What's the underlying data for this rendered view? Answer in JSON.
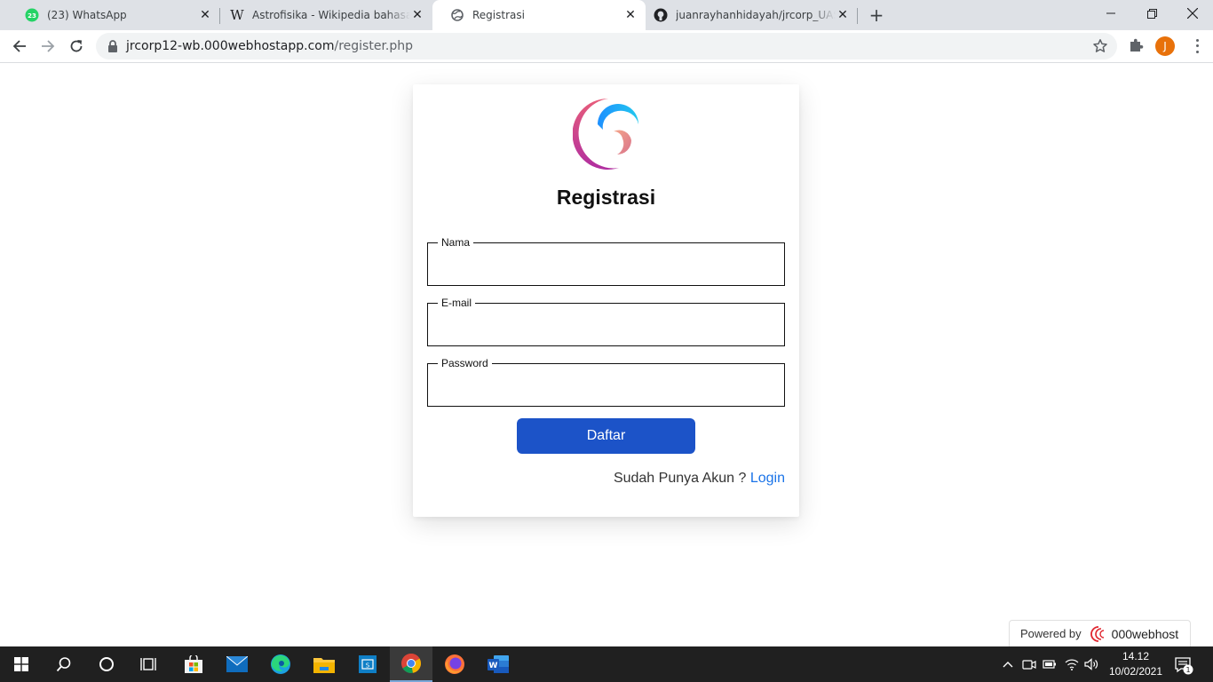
{
  "browser": {
    "tabs": [
      {
        "title": "(23) WhatsApp",
        "badge": "23",
        "icon": "whatsapp-icon",
        "active": false
      },
      {
        "title": "Astrofisika - Wikipedia bahasa Indonesia",
        "icon": "wikipedia-icon",
        "active": false
      },
      {
        "title": "Registrasi",
        "icon": "globe-icon",
        "active": true
      },
      {
        "title": "juanrayhanhidayah/jrcorp_UAS_web",
        "icon": "github-icon",
        "active": false
      }
    ],
    "new_tab": "+",
    "url_host": "jrcorp12-wb.000webhostapp.com",
    "url_path": "/register.php",
    "profile_initial": "J"
  },
  "form": {
    "heading": "Registrasi",
    "fields": [
      {
        "legend": "Nama",
        "value": ""
      },
      {
        "legend": "E-mail",
        "value": ""
      },
      {
        "legend": "Password",
        "value": ""
      }
    ],
    "submit_label": "Daftar",
    "login_prompt": "Sudah Punya Akun ?",
    "login_link": "Login"
  },
  "footer": {
    "powered_by": "Powered by",
    "brand": "000webhost"
  },
  "taskbar": {
    "apps": [
      "start-icon",
      "search-icon",
      "cortana-icon",
      "task-view-icon",
      "store-icon",
      "mail-icon",
      "edge-icon",
      "file-explorer-icon",
      "sway-icon",
      "chrome-icon",
      "firefox-icon",
      "word-icon"
    ],
    "time": "14.12",
    "date": "10/02/2021",
    "notification_count": "1"
  },
  "colors": {
    "accent_button": "#1c53c8",
    "link": "#1a73e8",
    "profile": "#e8710a",
    "whatsapp": "#25d366"
  }
}
